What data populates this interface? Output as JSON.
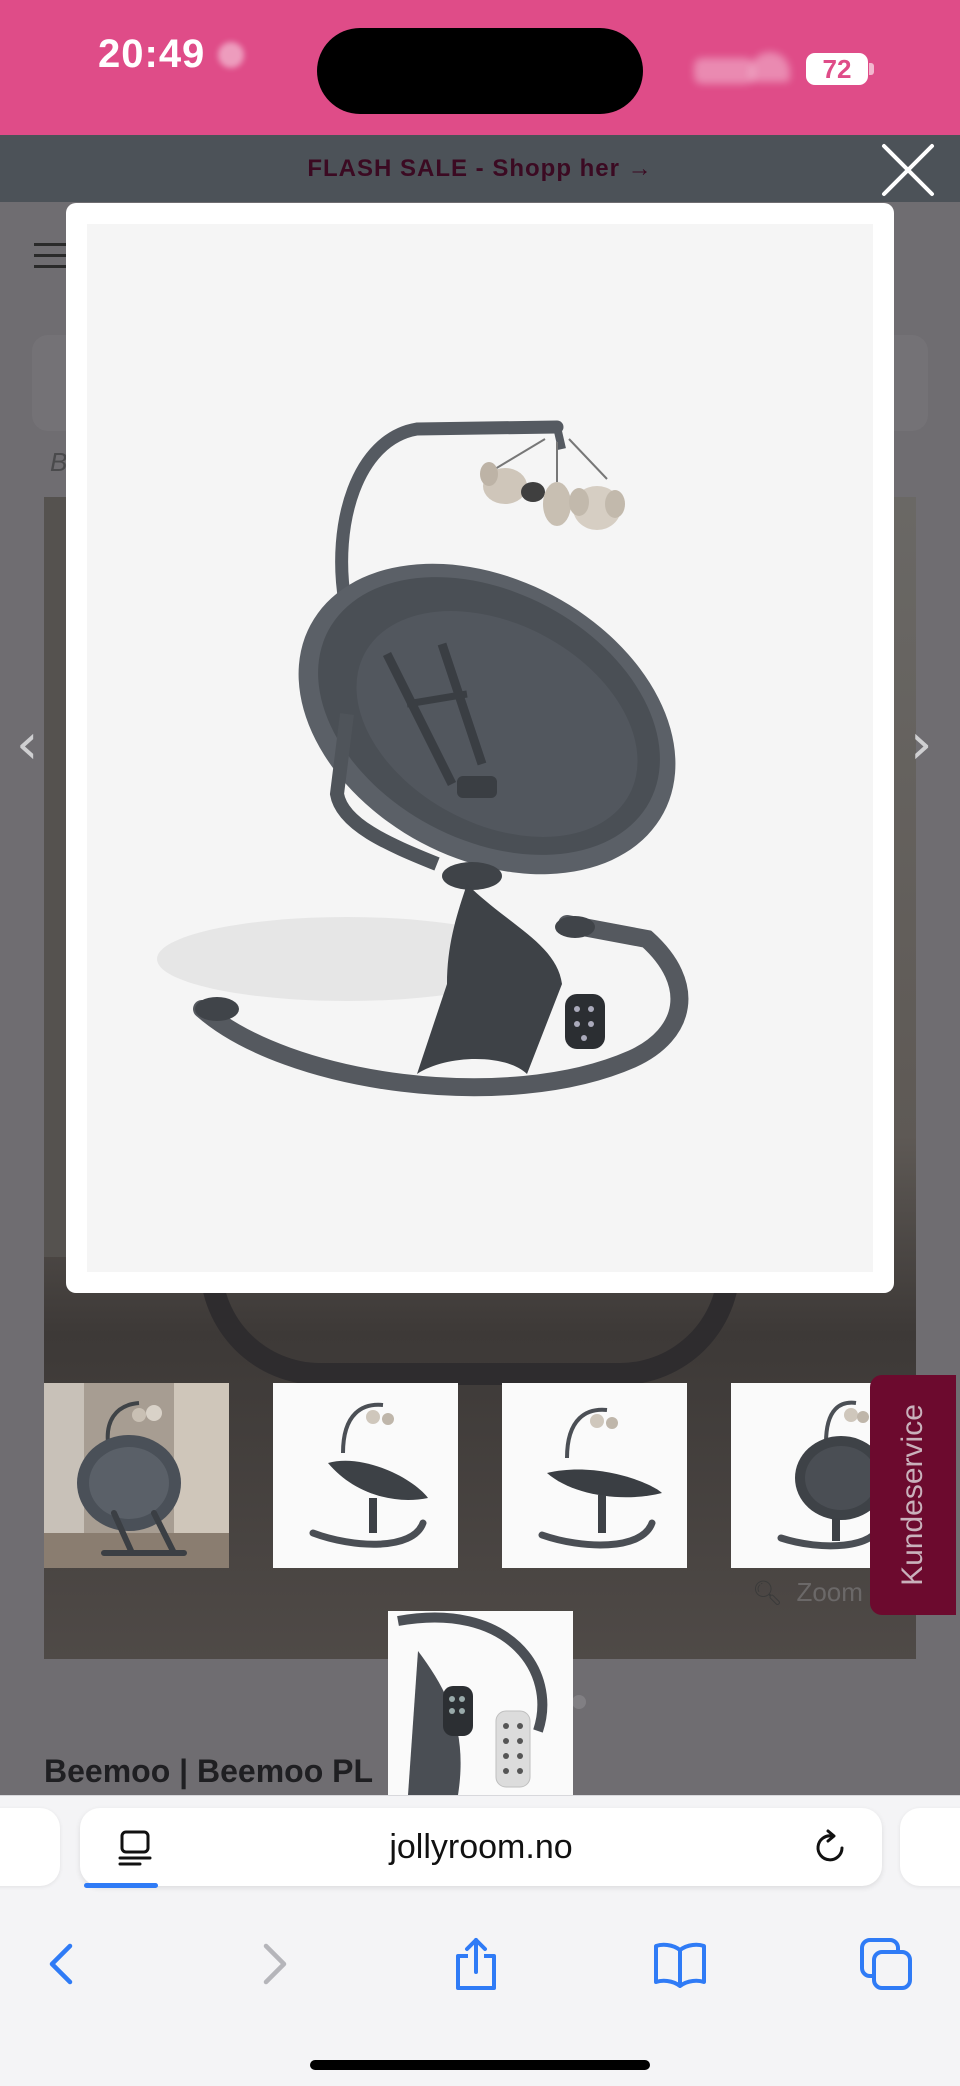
{
  "status_bar": {
    "time": "20:49",
    "battery": "72"
  },
  "banner": {
    "text": "FLASH SALE - Shopp her →"
  },
  "page": {
    "product_title": "Beemoo | Beemoo PL",
    "zoom_label": "Zoom",
    "customer_service": "Kundeservice",
    "breadcrumb_fragment": "B",
    "pager_prev": "‹",
    "pager_next": "›"
  },
  "thumbnails": [
    {
      "name": "lifestyle-photo"
    },
    {
      "name": "side-view"
    },
    {
      "name": "side-view-reclined"
    },
    {
      "name": "three-quarter-view"
    },
    {
      "name": "base-with-remote"
    }
  ],
  "browser": {
    "url": "jollyroom.no"
  },
  "icons": {
    "close": "close-icon",
    "back": "back-arrow-icon",
    "forward": "forward-arrow-icon",
    "share": "share-icon",
    "bookmarks": "bookmarks-icon",
    "tabs": "tabs-icon",
    "reader": "page-menu-icon",
    "reload": "reload-icon"
  },
  "colors": {
    "status_bar": "#df4c88",
    "accent_blue": "#2f7bf6",
    "customer_service": "#6c0a2e"
  }
}
